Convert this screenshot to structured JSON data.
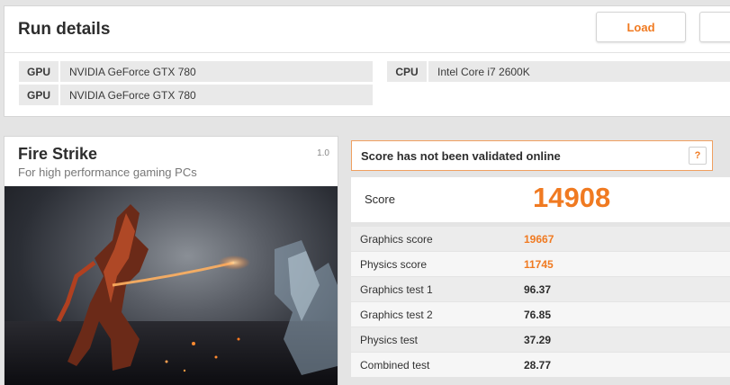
{
  "run_details": {
    "title": "Run details",
    "load_button": "Load",
    "specs": {
      "gpu1": {
        "label": "GPU",
        "value": "NVIDIA GeForce GTX 780"
      },
      "gpu2": {
        "label": "GPU",
        "value": "NVIDIA GeForce GTX 780"
      },
      "cpu": {
        "label": "CPU",
        "value": "Intel Core i7 2600K"
      }
    }
  },
  "benchmark": {
    "name": "Fire Strike",
    "subtitle": "For high performance gaming PCs",
    "version": "1.0"
  },
  "validation": {
    "message": "Score has not been validated online",
    "help_label": "?"
  },
  "score": {
    "label": "Score",
    "value": "14908"
  },
  "results": [
    {
      "label": "Graphics score",
      "value": "19667"
    },
    {
      "label": "Physics score",
      "value": "11745"
    },
    {
      "label": "Graphics test 1",
      "value": "96.37"
    },
    {
      "label": "Graphics test 2",
      "value": "76.85"
    },
    {
      "label": "Physics test",
      "value": "37.29"
    },
    {
      "label": "Combined test",
      "value": "28.77"
    }
  ],
  "colors": {
    "accent": "#f07a21",
    "validation_border": "#f0a060"
  }
}
